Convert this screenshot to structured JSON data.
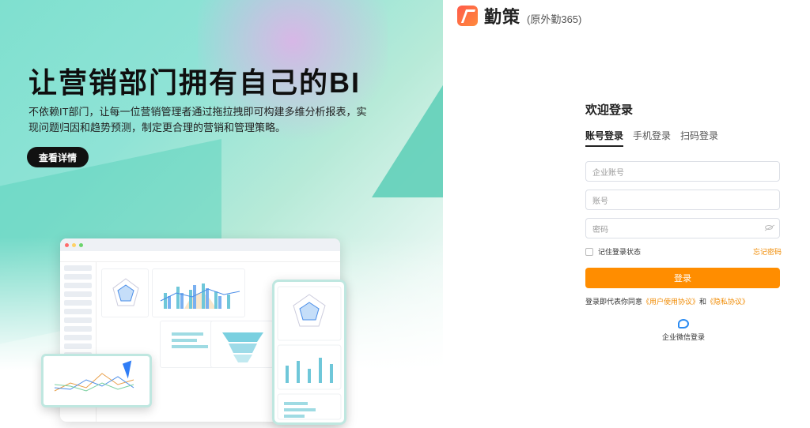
{
  "hero": {
    "title": "让营销部门拥有自己的BI",
    "description": "不依赖IT部门，让每一位营销管理者通过拖拉拽即可构建多维分析报表，实现问题归因和趋势预测，制定更合理的营销和管理策略。",
    "detail_button": "查看详情"
  },
  "brand": {
    "name": "勤策",
    "sub": "(原外勤365)",
    "icon": "brand-logo-icon"
  },
  "login": {
    "welcome": "欢迎登录",
    "tabs": [
      "账号登录",
      "手机登录",
      "扫码登录"
    ],
    "active_tab": "账号登录",
    "company_placeholder": "企业账号",
    "account_placeholder": "账号",
    "password_placeholder": "密码",
    "remember": "记住登录状态",
    "forgot": "忘记密码",
    "submit": "登录",
    "agree_prefix": "登录即代表你同意",
    "user_agreement": "《用户使用协议》",
    "and": "和",
    "privacy": "《隐私协议》",
    "wechat": "企业微信登录"
  },
  "colors": {
    "accent": "#ff8d00",
    "link": "#f08a00",
    "hero_teal": "#7fe0cf"
  }
}
